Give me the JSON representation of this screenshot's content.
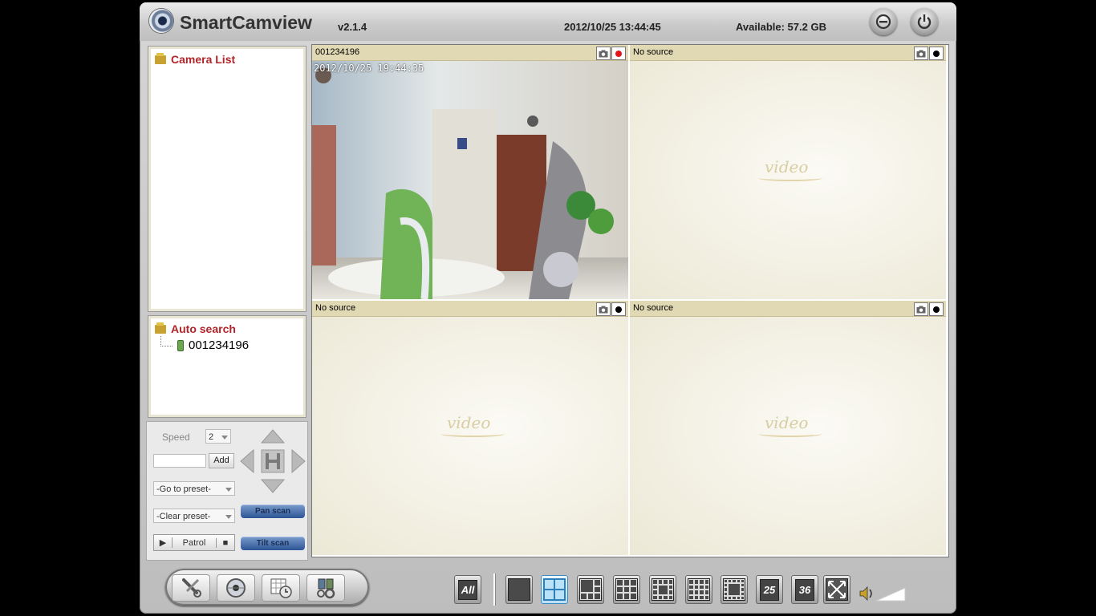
{
  "header": {
    "title": "SmartCamview",
    "version": "v2.1.4",
    "datetime": "2012/10/25 13:44:45",
    "available": "Available: 57.2 GB"
  },
  "camera_list": {
    "title": "Camera List"
  },
  "auto_search": {
    "title": "Auto search",
    "items": [
      "001234196"
    ]
  },
  "ptz": {
    "speed_label": "Speed",
    "speed_value": "2",
    "add_label": "Add",
    "goto_preset": "-Go to preset-",
    "clear_preset": "-Clear preset-",
    "patrol_label": "Patrol",
    "pan_scan": "Pan scan",
    "tilt_scan": "Tilt scan"
  },
  "cells": [
    {
      "title": "001234196",
      "recording": true,
      "osd": "2012/10/25 19:44:35"
    },
    {
      "title": "No source",
      "recording": false,
      "watermark": "video"
    },
    {
      "title": "No source",
      "recording": false,
      "watermark": "video"
    },
    {
      "title": "No source",
      "recording": false,
      "watermark": "video"
    }
  ],
  "layouts": {
    "all": "All",
    "l25": "25",
    "l36": "36",
    "active": "4-split"
  },
  "colors": {
    "accent_red": "#b0242a",
    "bar": "#e1d8b4",
    "rec_on": "#e4161b"
  }
}
